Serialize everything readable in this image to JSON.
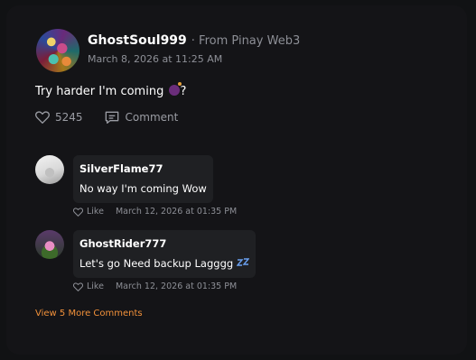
{
  "post": {
    "username": "GhostSoul999",
    "source": "· From Pinay Web3",
    "date": "March 8, 2026 at 11:25 AM",
    "text": "Try harder I'm coming",
    "text_suffix": "?",
    "likes": "5245",
    "comment_label": "Comment"
  },
  "comments": [
    {
      "username": "SilverFlame77",
      "text": "No way I'm coming Wow",
      "like_label": "Like",
      "time": "March 12, 2026 at 01:35 PM"
    },
    {
      "username": "GhostRider777",
      "text": "Let's go Need backup Lagggg",
      "like_label": "Like",
      "time": "March 12, 2026 at 01:35 PM"
    }
  ],
  "view_more": "View 5 More Comments",
  "colors": {
    "accent": "#f2913a",
    "background": "#141417",
    "bubble": "#1f2023"
  }
}
